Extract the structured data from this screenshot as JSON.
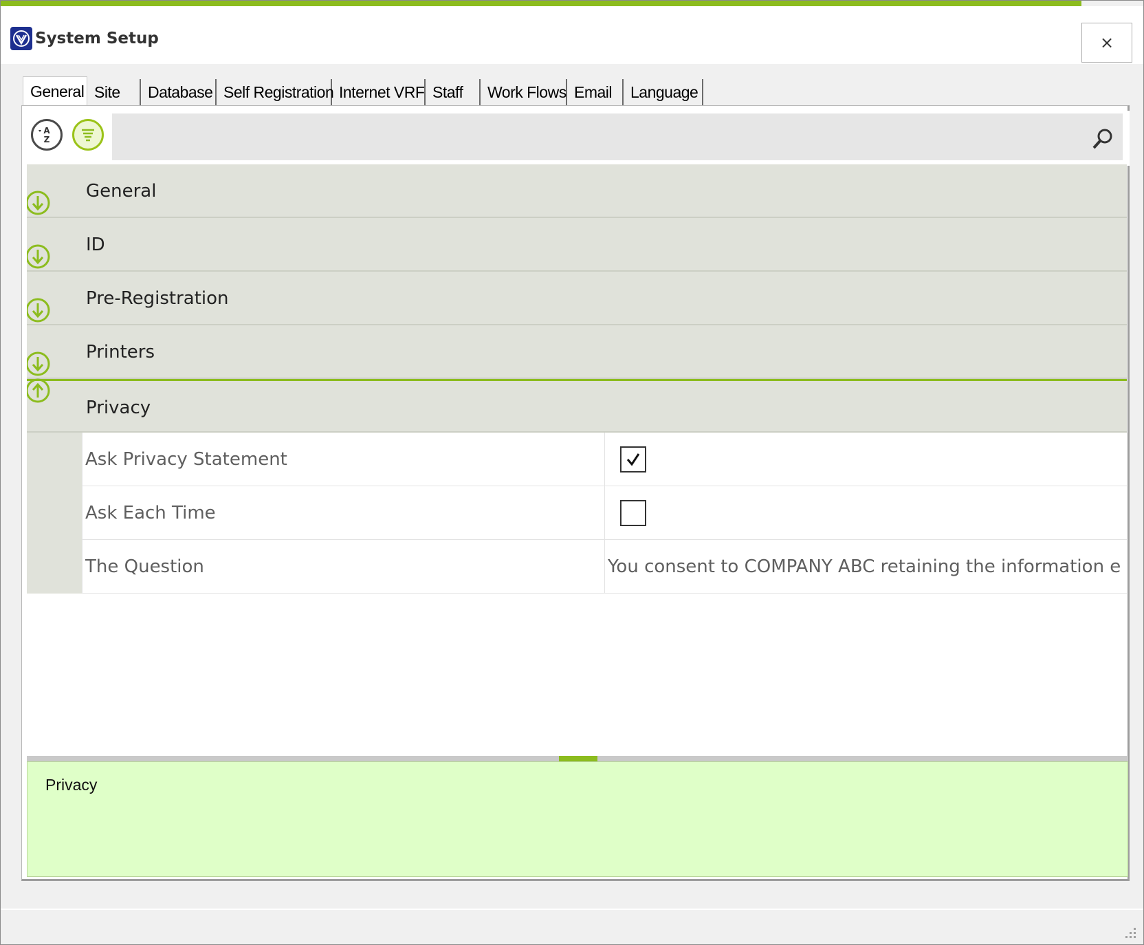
{
  "window": {
    "title": "System Setup",
    "close_label": "×",
    "accent_color": "#8cbc1e"
  },
  "tabs": [
    {
      "label": "General",
      "active": true
    },
    {
      "label": "Site"
    },
    {
      "label": "Database"
    },
    {
      "label": "Self Registration"
    },
    {
      "label": "Internet VRF"
    },
    {
      "label": "Staff"
    },
    {
      "label": "Work Flows"
    },
    {
      "label": "Email"
    },
    {
      "label": "Language"
    }
  ],
  "toolbar": {
    "sort_alpha_icon": "sort-alphabetical-icon",
    "sort_category_icon": "sort-categorized-icon",
    "search_value": "",
    "search_icon": "search-icon"
  },
  "categories": [
    {
      "label": "General",
      "expanded": false
    },
    {
      "label": "ID",
      "expanded": false
    },
    {
      "label": "Pre-Registration",
      "expanded": false
    },
    {
      "label": "Printers",
      "expanded": false
    },
    {
      "label": "Privacy",
      "expanded": true
    }
  ],
  "privacy_properties": [
    {
      "name": "Ask Privacy Statement",
      "type": "checkbox",
      "checked": true
    },
    {
      "name": "Ask Each Time",
      "type": "checkbox",
      "checked": false
    },
    {
      "name": "The Question",
      "type": "text",
      "value": "You consent to COMPANY ABC retaining the information e"
    }
  ],
  "description": {
    "title": "Privacy",
    "background": "#dfffc8"
  }
}
